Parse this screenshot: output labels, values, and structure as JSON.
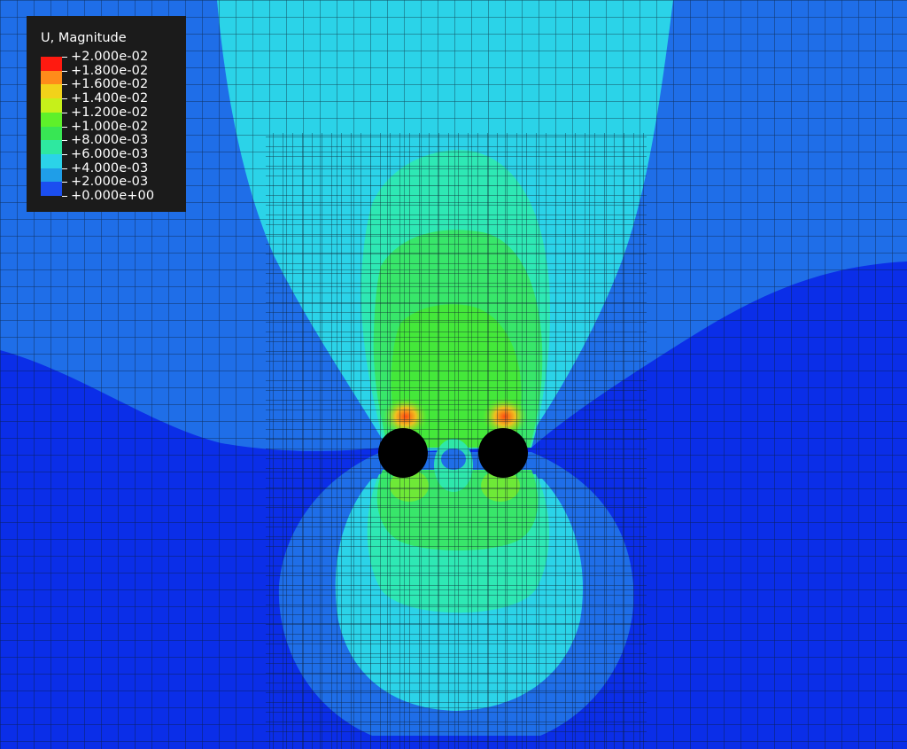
{
  "legend": {
    "title": "U, Magnitude",
    "labels": [
      "+2.000e-02",
      "+1.800e-02",
      "+1.600e-02",
      "+1.400e-02",
      "+1.200e-02",
      "+1.000e-02",
      "+8.000e-03",
      "+6.000e-03",
      "+4.000e-03",
      "+2.000e-03",
      "+0.000e+00"
    ],
    "colors": [
      "#ff1a10",
      "#ff8c1a",
      "#f2d21a",
      "#c6f01a",
      "#5ef02a",
      "#38e654",
      "#2ee8a0",
      "#2bd3e8",
      "#1f9ee8",
      "#1b4ef0"
    ]
  },
  "field_colors": {
    "background_low": "#0b2ee8",
    "band_2e-3": "#1f6ee8",
    "band_4e-3": "#2bd3e8",
    "band_6e-3": "#2ee8b4",
    "band_8e-3": "#38e66a",
    "band_1e-2": "#3ee83a",
    "band_hot": "#ff5a10",
    "mesh_lines": "#0c1a2a",
    "holes": "#000000"
  }
}
